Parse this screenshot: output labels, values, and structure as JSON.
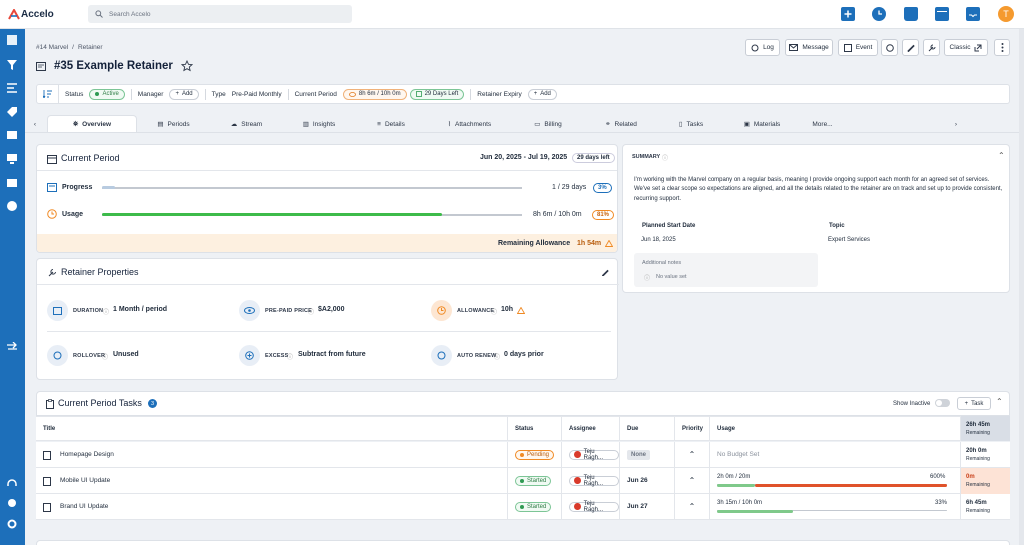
{
  "app": {
    "name": "Accelo",
    "search_placeholder": "Search Accelo",
    "avatar_letter": "T"
  },
  "breadcrumb": {
    "project": "#14 Marvel",
    "section": "Retainer"
  },
  "page": {
    "title": "#35 Example Retainer"
  },
  "actions": {
    "log": "Log",
    "message": "Message",
    "event": "Event",
    "classic": "Classic"
  },
  "info": {
    "status_label": "Status",
    "status_value": "Active",
    "manager_label": "Manager",
    "add": "Add",
    "type_label": "Type",
    "type_value": "Pre-Paid Monthly",
    "current_period_label": "Current Period",
    "period_usage": "8h 6m / 10h 0m",
    "days_left": "29 Days Left",
    "expiry_label": "Retainer Expiry"
  },
  "tabs": [
    "Overview",
    "Periods",
    "Stream",
    "Insights",
    "Details",
    "Attachments",
    "Billing",
    "Related",
    "Tasks",
    "Materials",
    "More..."
  ],
  "current_period": {
    "title": "Current Period",
    "dates": "Jun 20, 2025 - Jul 19, 2025",
    "days_left": "29 days left",
    "progress_label": "Progress",
    "progress_value": "1 / 29 days",
    "progress_pct": "3%",
    "progress_fraction": 0.03,
    "usage_label": "Usage",
    "usage_value": "8h 6m / 10h 0m",
    "usage_pct": "81%",
    "usage_fraction": 0.81,
    "remaining_label": "Remaining Allowance",
    "remaining_value": "1h 54m"
  },
  "properties": {
    "title": "Retainer Properties",
    "duration_label": "DURATION",
    "duration_value": "1 Month / period",
    "prepaid_label": "PRE-PAID PRICE",
    "prepaid_value": "$A2,000",
    "allowance_label": "ALLOWANCE",
    "allowance_value": "10h",
    "rollover_label": "ROLLOVER",
    "rollover_value": "Unused",
    "excess_label": "EXCESS",
    "excess_value": "Subtract from future",
    "autorenew_label": "AUTO RENEW",
    "autorenew_value": "0 days prior"
  },
  "summary": {
    "title": "SUMMARY",
    "text": "I'm working with the Marvel company on a regular basis, meaning I provide ongoing support each month for an agreed set of services. We've set a clear scope so expectations are aligned, and all the details related to the retainer are on track and set up to provide consistent, recurring support.",
    "start_label": "Planned Start Date",
    "start_value": "Jun 18, 2025",
    "topic_label": "Topic",
    "topic_value": "Expert Services",
    "notes_label": "Additional notes",
    "notes_value": "No value set"
  },
  "tasks": {
    "title": "Current Period Tasks",
    "count": "3",
    "show_inactive": "Show Inactive",
    "add_task": "Task",
    "columns": {
      "title": "Title",
      "status": "Status",
      "assignee": "Assignee",
      "due": "Due",
      "priority": "Priority",
      "usage": "Usage",
      "remaining_total": "26h 45m",
      "remaining_label": "Remaining"
    },
    "rows": [
      {
        "title": "Homepage Design",
        "status": "Pending",
        "assignee": "Teju Ragh...",
        "due": "None",
        "usage_text": "No Budget Set",
        "usage_pct": "",
        "remaining": "20h 0m",
        "remaining_label": "Remaining",
        "fill": 0
      },
      {
        "title": "Mobile UI Update",
        "status": "Started",
        "assignee": "Teju Ragh...",
        "due": "Jun 26",
        "usage_text": "2h 0m / 20m",
        "usage_pct": "600%",
        "remaining": "0m",
        "remaining_label": "Remaining",
        "fill": 6
      },
      {
        "title": "Brand UI Update",
        "status": "Started",
        "assignee": "Teju Ragh...",
        "due": "Jun 27",
        "usage_text": "3h 15m / 10h 0m",
        "usage_pct": "33%",
        "remaining": "6h 45m",
        "remaining_label": "Remaining",
        "fill": 0.33
      }
    ]
  },
  "colors": {
    "brand": "#1d6fba",
    "active": "#2f9a52",
    "warning": "#f08a24",
    "over": "#e0522a"
  }
}
